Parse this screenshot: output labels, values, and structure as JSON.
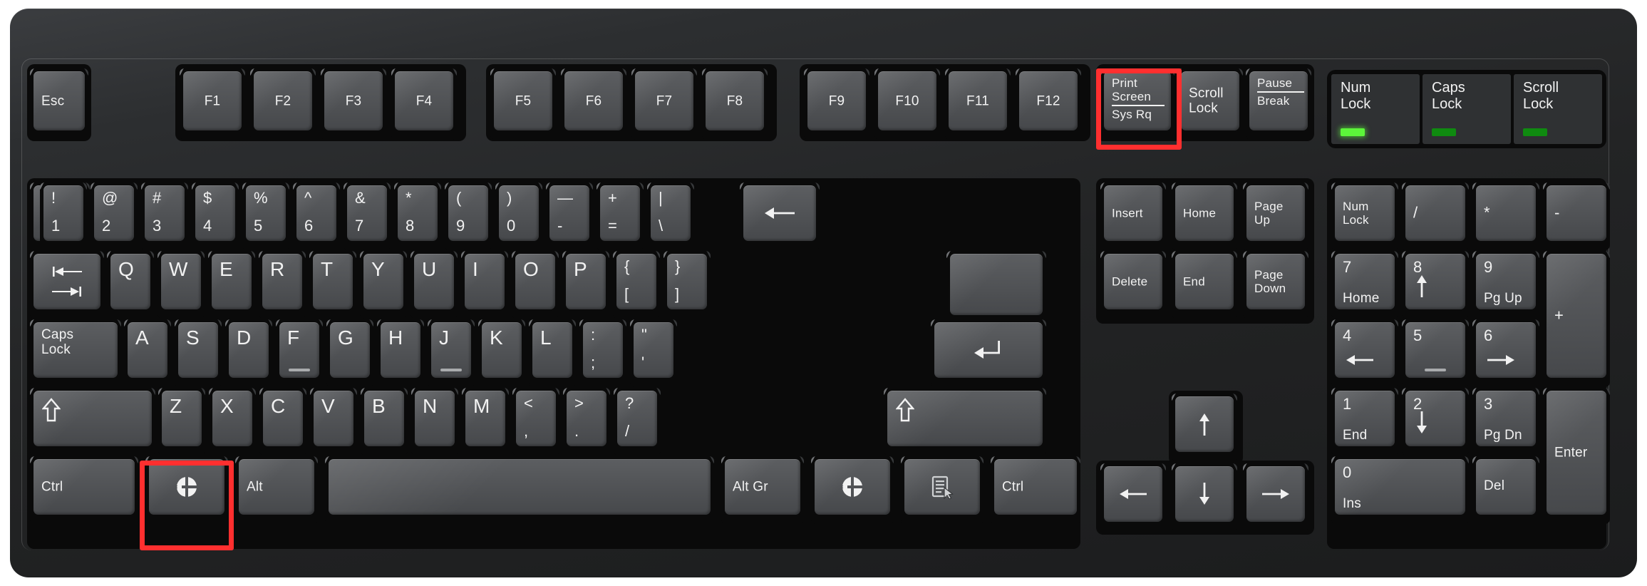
{
  "device": {
    "name": "104-key full-size PC keyboard diagram",
    "body_color": "#2a2c2e",
    "key_color": "#555759",
    "legend_color": "#f2f2f2",
    "highlight_color": "#ff2f2f"
  },
  "highlights": [
    {
      "name": "print-screen-highlight",
      "target": "Print Screen / Sys Rq"
    },
    {
      "name": "left-super-highlight",
      "target": "Left Windows / Super key"
    }
  ],
  "indicators": [
    {
      "label": "Num\nLock",
      "state": "on",
      "lamp_color": "#5cf53a"
    },
    {
      "label": "Caps\nLock",
      "state": "off",
      "lamp_color": "#0f8a10"
    },
    {
      "label": "Scroll\nLock",
      "state": "off",
      "lamp_color": "#0f8a10"
    }
  ],
  "rows": {
    "function_row": [
      {
        "legend": "Esc"
      },
      {
        "legend": "F1"
      },
      {
        "legend": "F2"
      },
      {
        "legend": "F3"
      },
      {
        "legend": "F4"
      },
      {
        "legend": "F5"
      },
      {
        "legend": "F6"
      },
      {
        "legend": "F7"
      },
      {
        "legend": "F8"
      },
      {
        "legend": "F9"
      },
      {
        "legend": "F10"
      },
      {
        "legend": "F11"
      },
      {
        "legend": "F12"
      },
      {
        "legend_top": "Print\nScreen",
        "legend_bottom": "Sys Rq"
      },
      {
        "legend": "Scroll\nLock"
      },
      {
        "legend_top": "Pause",
        "legend_bottom": "Break"
      }
    ],
    "number_row": [
      {
        "shift": "~",
        "base": "`   \\"
      },
      {
        "shift": "!",
        "base": "1"
      },
      {
        "shift": "@",
        "base": "2"
      },
      {
        "shift": "#",
        "base": "3"
      },
      {
        "shift": "$",
        "base": "4"
      },
      {
        "shift": "%",
        "base": "5"
      },
      {
        "shift": "^",
        "base": "6"
      },
      {
        "shift": "&",
        "base": "7"
      },
      {
        "shift": "*",
        "base": "8"
      },
      {
        "shift": "(",
        "base": "9"
      },
      {
        "shift": ")",
        "base": "0"
      },
      {
        "shift": "—",
        "base": "-"
      },
      {
        "shift": "+",
        "base": "="
      },
      {
        "shift": "|",
        "base": "\\"
      },
      {
        "icon": "backspace-arrow-icon"
      }
    ],
    "top_row": [
      {
        "icon": "tab-arrows-icon"
      },
      {
        "legend": "Q"
      },
      {
        "legend": "W"
      },
      {
        "legend": "E"
      },
      {
        "legend": "R"
      },
      {
        "legend": "T"
      },
      {
        "legend": "Y"
      },
      {
        "legend": "U"
      },
      {
        "legend": "I"
      },
      {
        "legend": "O"
      },
      {
        "legend": "P"
      },
      {
        "shift": "{",
        "base": "["
      },
      {
        "shift": "}",
        "base": "]"
      }
    ],
    "home_row": [
      {
        "legend": "Caps\nLock"
      },
      {
        "legend": "A"
      },
      {
        "legend": "S"
      },
      {
        "legend": "D"
      },
      {
        "legend": "F",
        "homing": true
      },
      {
        "legend": "G"
      },
      {
        "legend": "H"
      },
      {
        "legend": "J",
        "homing": true
      },
      {
        "legend": "K"
      },
      {
        "legend": "L"
      },
      {
        "shift": ":",
        "base": ";"
      },
      {
        "shift": "\"",
        "base": "'"
      },
      {
        "icon": "enter-arrow-icon"
      }
    ],
    "bottom_letter_row": [
      {
        "icon": "shift-up-arrow-icon"
      },
      {
        "legend": "Z"
      },
      {
        "legend": "X"
      },
      {
        "legend": "C"
      },
      {
        "legend": "V"
      },
      {
        "legend": "B"
      },
      {
        "legend": "N"
      },
      {
        "legend": "M"
      },
      {
        "shift": "<",
        "base": ","
      },
      {
        "shift": ">",
        "base": "."
      },
      {
        "shift": "?",
        "base": "/"
      },
      {
        "icon": "shift-up-arrow-icon"
      }
    ],
    "modifier_row": [
      {
        "legend": "Ctrl"
      },
      {
        "icon": "windows-logo-icon"
      },
      {
        "legend": "Alt"
      },
      {
        "legend": "",
        "name": "spacebar"
      },
      {
        "legend": "Alt Gr"
      },
      {
        "icon": "windows-logo-icon"
      },
      {
        "icon": "menu-key-icon"
      },
      {
        "legend": "Ctrl"
      }
    ]
  },
  "nav_cluster": [
    {
      "legend": "Insert"
    },
    {
      "legend": "Home"
    },
    {
      "legend": "Page\nUp"
    },
    {
      "legend": "Delete"
    },
    {
      "legend": "End"
    },
    {
      "legend": "Page\nDown"
    }
  ],
  "arrow_cluster": [
    {
      "icon": "arrow-up-icon",
      "name": "arrow-up-key"
    },
    {
      "icon": "arrow-left-icon",
      "name": "arrow-left-key"
    },
    {
      "icon": "arrow-down-icon",
      "name": "arrow-down-key"
    },
    {
      "icon": "arrow-right-icon",
      "name": "arrow-right-key"
    }
  ],
  "numpad": [
    {
      "legend": "Num\nLock"
    },
    {
      "legend": "/"
    },
    {
      "legend": "*"
    },
    {
      "legend": "-"
    },
    {
      "num": "7",
      "fn": "Home"
    },
    {
      "num": "8",
      "fn_icon": "arrow-up-icon"
    },
    {
      "num": "9",
      "fn": "Pg Up"
    },
    {
      "legend": "+"
    },
    {
      "num": "4",
      "fn_icon": "arrow-left-icon"
    },
    {
      "num": "5",
      "fn": "",
      "homing": true
    },
    {
      "num": "6",
      "fn_icon": "arrow-right-icon"
    },
    {
      "num": "1",
      "fn": "End"
    },
    {
      "num": "2",
      "fn_icon": "arrow-down-icon"
    },
    {
      "num": "3",
      "fn": "Pg Dn"
    },
    {
      "legend": "Enter"
    },
    {
      "num": "0",
      "fn": "Ins"
    },
    {
      "fn": "Del",
      "name": "numpad-del-key"
    }
  ]
}
